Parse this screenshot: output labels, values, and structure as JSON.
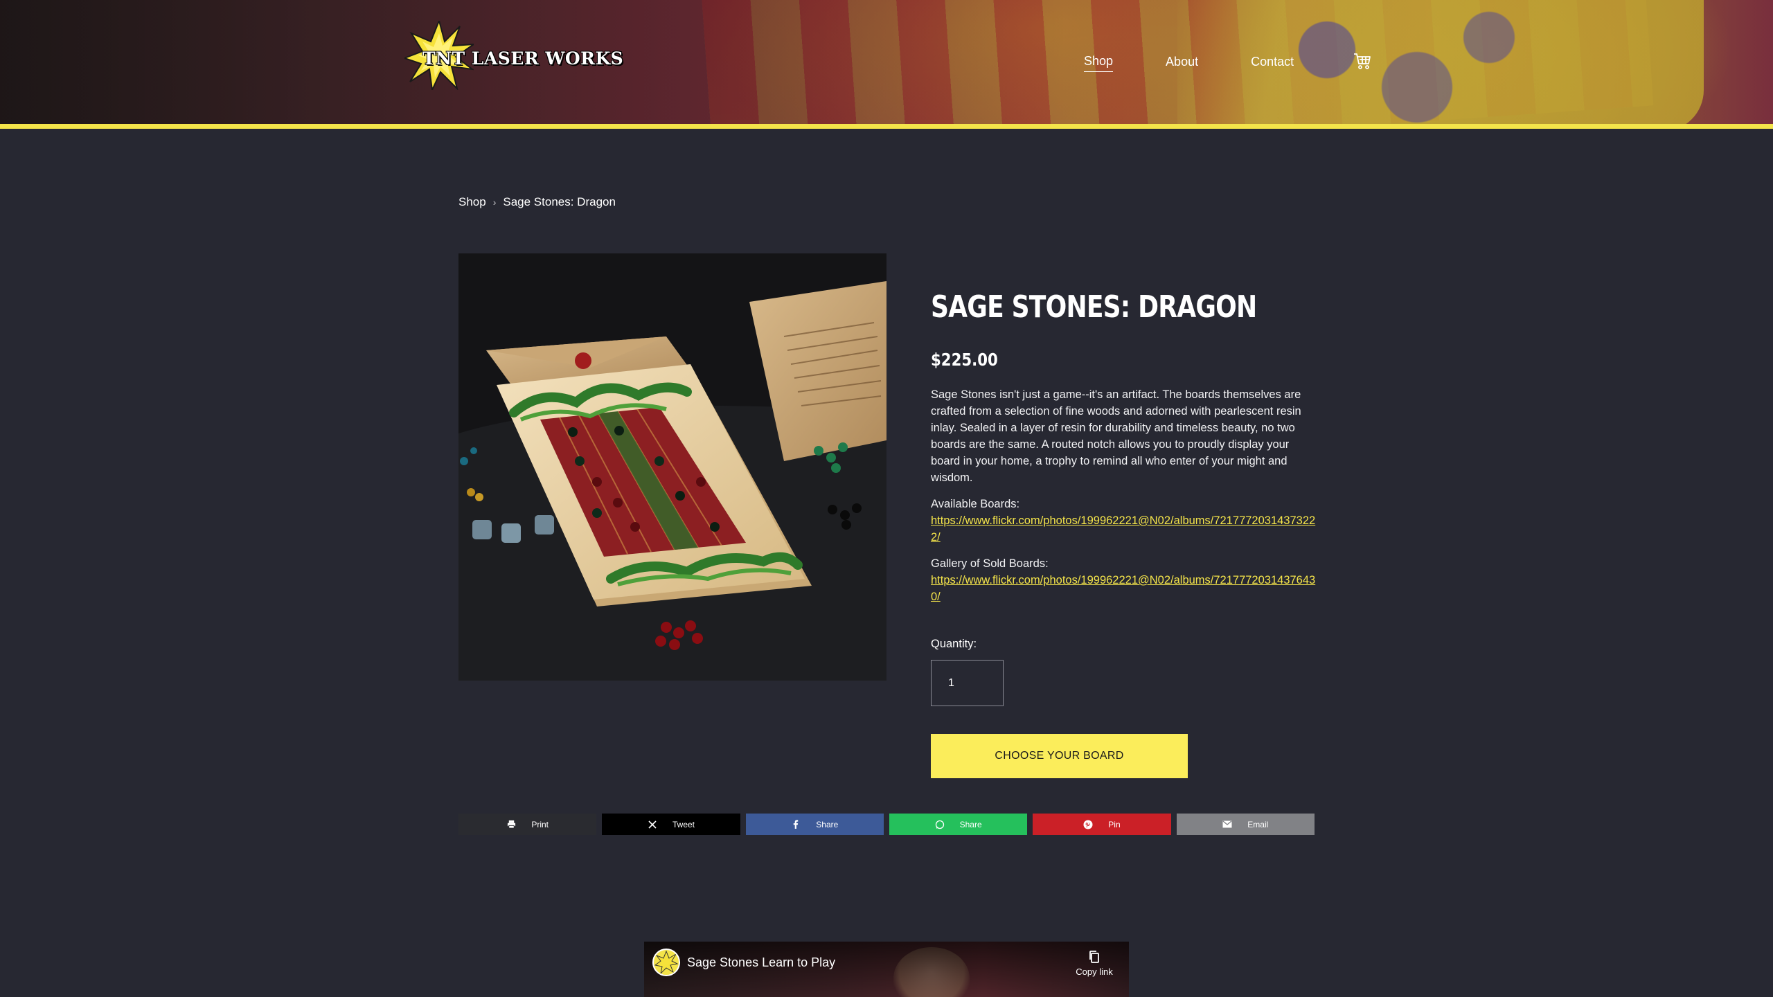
{
  "brand": {
    "logo_text": "TNT LASER WORKS"
  },
  "nav": {
    "items": [
      {
        "label": "Shop",
        "active": true
      },
      {
        "label": "About",
        "active": false
      },
      {
        "label": "Contact",
        "active": false
      }
    ],
    "cart_icon": "cart-icon"
  },
  "breadcrumb": {
    "parent": "Shop",
    "separator": "›",
    "current": "Sage Stones: Dragon"
  },
  "product": {
    "title": "SAGE STONES: DRAGON",
    "price": "$225.00",
    "description": "Sage Stones isn't just a game--it's an artifact. The boards themselves are crafted from a selection of fine woods and adorned with pearlescent resin inlay. Sealed in a layer of resin for durability and timeless beauty, no two boards are the same. A routed notch allows you to proudly display your board in your home, a trophy to remind all who enter of your might and wisdom.",
    "available_label": "Available Boards:",
    "available_url": "https://www.flickr.com/photos/199962221@N02/albums/72177720314373222/",
    "gallery_label": "Gallery of Sold Boards:",
    "gallery_url": "https://www.flickr.com/photos/199962221@N02/albums/72177720314376430/",
    "quantity_label": "Quantity:",
    "quantity_value": "1",
    "cta_label": "CHOOSE YOUR BOARD"
  },
  "share": {
    "buttons": [
      {
        "label": "Print",
        "icon": "printer-icon"
      },
      {
        "label": "Tweet",
        "icon": "x-icon"
      },
      {
        "label": "Share",
        "icon": "facebook-icon"
      },
      {
        "label": "Share",
        "icon": "whatsapp-icon"
      },
      {
        "label": "Pin",
        "icon": "pinterest-icon"
      },
      {
        "label": "Email",
        "icon": "email-icon"
      }
    ]
  },
  "video": {
    "title": "Sage Stones Learn to Play",
    "copy_link_label": "Copy link"
  },
  "colors": {
    "background": "#272832",
    "accent_yellow": "#fbed5b",
    "header_rule": "#f4e44a",
    "link": "#f4e44a",
    "facebook": "#3d5a98",
    "whatsapp": "#25c05c",
    "pinterest": "#cb2027",
    "email": "#818286"
  }
}
